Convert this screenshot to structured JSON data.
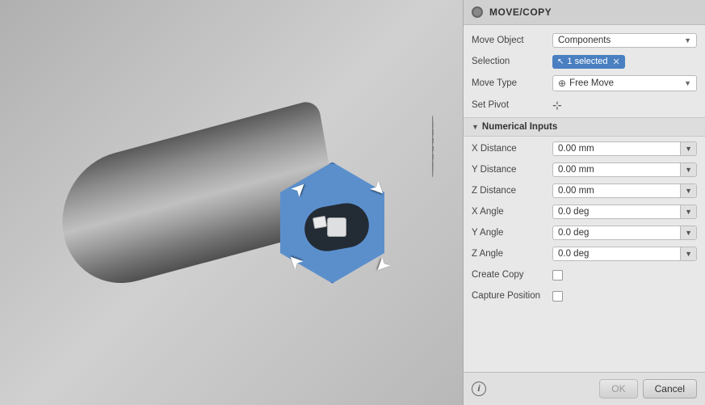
{
  "panel": {
    "title": "MOVE/COPY",
    "rows": {
      "move_object_label": "Move Object",
      "move_object_value": "Components",
      "selection_label": "Selection",
      "selection_badge": "1 selected",
      "move_type_label": "Move Type",
      "move_type_value": "Free Move",
      "set_pivot_label": "Set Pivot",
      "numerical_inputs_label": "Numerical Inputs",
      "x_distance_label": "X Distance",
      "x_distance_value": "0.00 mm",
      "y_distance_label": "Y Distance",
      "y_distance_value": "0.00 mm",
      "z_distance_label": "Z Distance",
      "z_distance_value": "0.00 mm",
      "x_angle_label": "X Angle",
      "x_angle_value": "0.0 deg",
      "y_angle_label": "Y Angle",
      "y_angle_value": "0.0 deg",
      "z_angle_label": "Z Angle",
      "z_angle_value": "0.0 deg",
      "create_copy_label": "Create Copy",
      "capture_position_label": "Capture Position"
    },
    "footer": {
      "ok_label": "OK",
      "cancel_label": "Cancel"
    }
  },
  "icons": {
    "dropdown_arrow": "▼",
    "section_arrow": "▼",
    "close_x": "✕",
    "cursor_icon": "↖",
    "pivot_icon": "⊹",
    "free_move_icon": "⊕",
    "info": "i"
  }
}
